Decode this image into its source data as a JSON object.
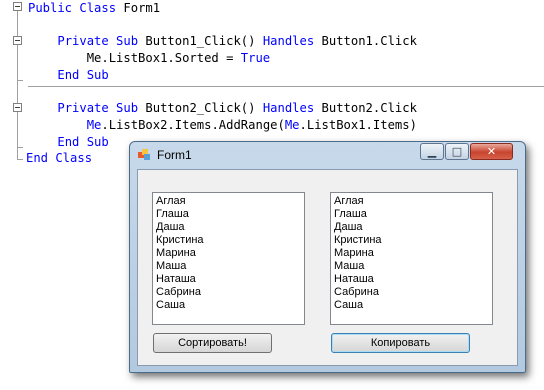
{
  "code": {
    "lines": [
      [
        {
          "t": "Public Class ",
          "k": true
        },
        {
          "t": "Form1",
          "k": false
        }
      ],
      [],
      [
        {
          "t": "    ",
          "k": false
        },
        {
          "t": "Private Sub ",
          "k": true
        },
        {
          "t": "Button1_Click() ",
          "k": false
        },
        {
          "t": "Handles ",
          "k": true
        },
        {
          "t": "Button1.Click",
          "k": false
        }
      ],
      [
        {
          "t": "        Me",
          "k": false
        },
        {
          "t": "",
          "k": true
        },
        {
          "t": ".ListBox1.Sorted = ",
          "k": false
        },
        {
          "t": "True",
          "k": true
        }
      ],
      [
        {
          "t": "    ",
          "k": false
        },
        {
          "t": "End Sub",
          "k": true
        }
      ],
      [],
      [
        {
          "t": "    ",
          "k": false
        },
        {
          "t": "Private Sub ",
          "k": true
        },
        {
          "t": "Button2_Click() ",
          "k": false
        },
        {
          "t": "Handles ",
          "k": true
        },
        {
          "t": "Button2.Click",
          "k": false
        }
      ],
      [
        {
          "t": "        ",
          "k": false
        },
        {
          "t": "Me",
          "k": true
        },
        {
          "t": ".ListBox2.Items.AddRange(",
          "k": false
        },
        {
          "t": "Me",
          "k": true
        },
        {
          "t": ".ListBox1.Items)",
          "k": false
        }
      ],
      [
        {
          "t": "    ",
          "k": false
        },
        {
          "t": "End Sub",
          "k": true
        }
      ],
      [
        {
          "t": "End Class",
          "k": true
        }
      ]
    ]
  },
  "window": {
    "title": "Form1",
    "min_glyph": "▁",
    "max_glyph": "□",
    "close_glyph": "✕",
    "icon": "form-app-icon"
  },
  "listbox1": {
    "items": [
      "Аглая",
      "Глаша",
      "Даша",
      "Кристина",
      "Марина",
      "Маша",
      "Наташа",
      "Сабрина",
      "Саша"
    ]
  },
  "listbox2": {
    "items": [
      "Аглая",
      "Глаша",
      "Даша",
      "Кристина",
      "Марина",
      "Маша",
      "Наташа",
      "Сабрина",
      "Саша"
    ]
  },
  "buttons": {
    "sort_label": "Сортировать!",
    "copy_label": "Копировать"
  },
  "colors": {
    "keyword": "#0000ff",
    "code_text": "#000000",
    "close_button": "#c8442f"
  }
}
